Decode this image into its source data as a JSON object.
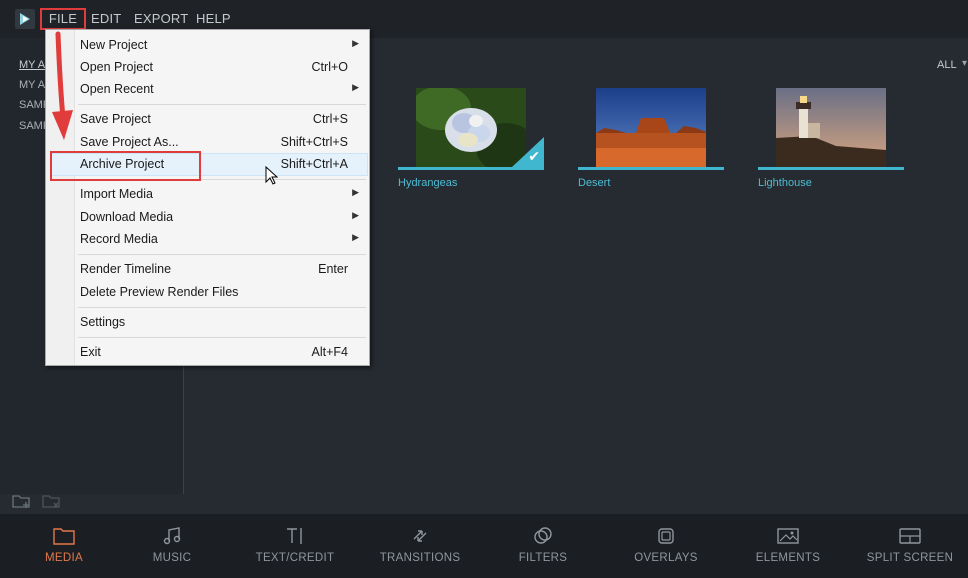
{
  "menubar": {
    "items": [
      "FILE",
      "EDIT",
      "EXPORT",
      "HELP"
    ]
  },
  "left_panel": {
    "items": [
      "MY A",
      "MY A",
      "SAMP",
      "SAMP"
    ]
  },
  "main": {
    "filter_label": "ALL",
    "media": [
      {
        "name": "Hydrangeas",
        "selected": true
      },
      {
        "name": "Desert",
        "selected": false
      },
      {
        "name": "Lighthouse",
        "selected": false
      }
    ]
  },
  "file_menu": {
    "items": [
      {
        "label": "New Project",
        "shortcut": "",
        "submenu": true
      },
      {
        "label": "Open Project",
        "shortcut": "Ctrl+O",
        "submenu": false
      },
      {
        "label": "Open Recent",
        "shortcut": "",
        "submenu": true
      },
      {
        "label": "Save Project",
        "shortcut": "Ctrl+S",
        "submenu": false
      },
      {
        "label": "Save Project As...",
        "shortcut": "Shift+Ctrl+S",
        "submenu": false
      },
      {
        "label": "Archive Project",
        "shortcut": "Shift+Ctrl+A",
        "submenu": false
      },
      {
        "label": "Import Media",
        "shortcut": "",
        "submenu": true
      },
      {
        "label": "Download Media",
        "shortcut": "",
        "submenu": true
      },
      {
        "label": "Record Media",
        "shortcut": "",
        "submenu": true
      },
      {
        "label": "Render Timeline",
        "shortcut": "Enter",
        "submenu": false
      },
      {
        "label": "Delete Preview Render Files",
        "shortcut": "",
        "submenu": false
      },
      {
        "label": "Settings",
        "shortcut": "",
        "submenu": false
      },
      {
        "label": "Exit",
        "shortcut": "Alt+F4",
        "submenu": false
      }
    ]
  },
  "bottom_toolbar": {
    "items": [
      {
        "label": "MEDIA",
        "icon": "folder-icon",
        "active": true
      },
      {
        "label": "MUSIC",
        "icon": "music-note-icon",
        "active": false
      },
      {
        "label": "TEXT/CREDIT",
        "icon": "text-cursor-icon",
        "active": false
      },
      {
        "label": "TRANSITIONS",
        "icon": "transitions-icon",
        "active": false
      },
      {
        "label": "FILTERS",
        "icon": "filters-icon",
        "active": false
      },
      {
        "label": "OVERLAYS",
        "icon": "overlays-icon",
        "active": false
      },
      {
        "label": "ELEMENTS",
        "icon": "image-icon",
        "active": false
      },
      {
        "label": "SPLIT SCREEN",
        "icon": "split-screen-icon",
        "active": false
      }
    ]
  },
  "colors": {
    "accent": "#41b6cf",
    "active_tab": "#e2794a",
    "annotation_red": "#e03c3c"
  }
}
